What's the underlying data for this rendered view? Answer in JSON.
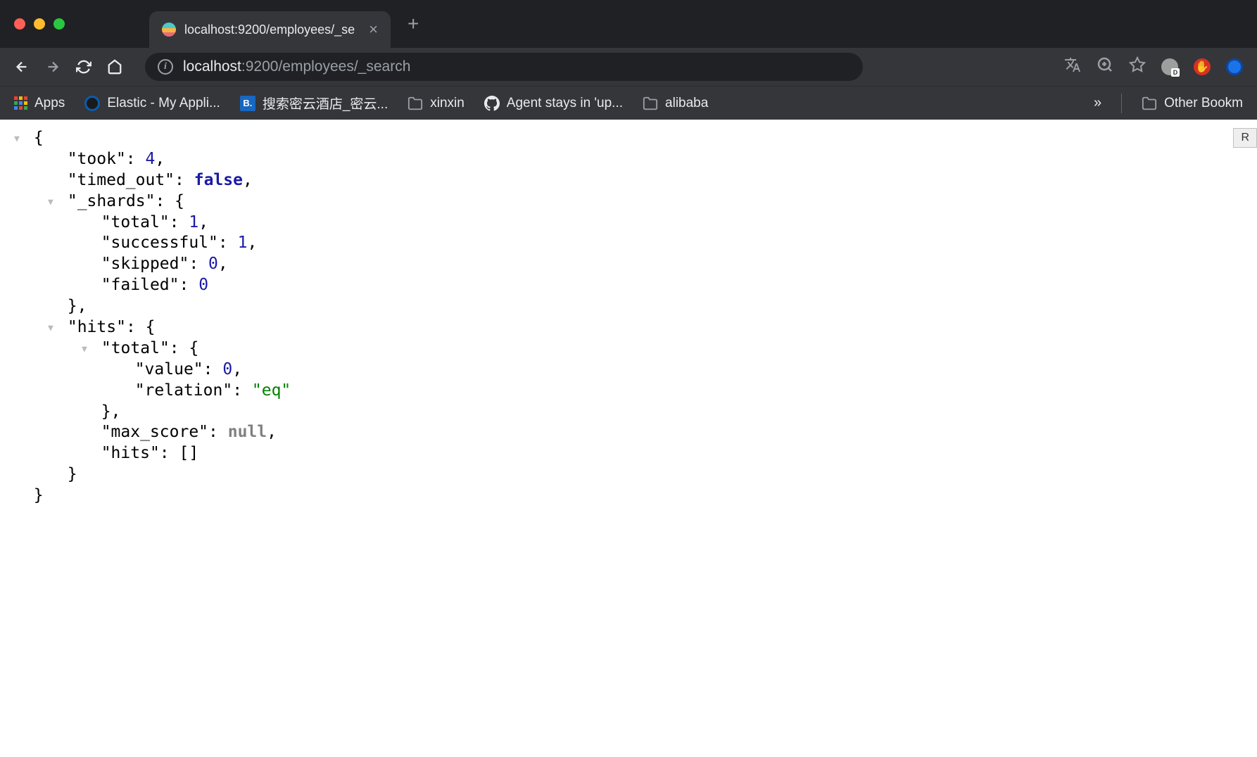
{
  "tab": {
    "title": "localhost:9200/employees/_se"
  },
  "url": {
    "host": "localhost",
    "rest": ":9200/employees/_search"
  },
  "bookmarks": {
    "apps": "Apps",
    "items": [
      {
        "label": "Elastic - My Appli...",
        "icon": "elastic"
      },
      {
        "label": "搜索密云酒店_密云...",
        "icon": "b"
      },
      {
        "label": "xinxin",
        "icon": "folder"
      },
      {
        "label": "Agent stays in 'up...",
        "icon": "github"
      },
      {
        "label": "alibaba",
        "icon": "folder"
      }
    ],
    "other": "Other Bookm"
  },
  "sidebutton": "R",
  "json": {
    "took": 4,
    "timed_out": false,
    "_shards": {
      "total": 1,
      "successful": 1,
      "skipped": 0,
      "failed": 0
    },
    "hits": {
      "total": {
        "value": 0,
        "relation": "eq"
      },
      "max_score": null,
      "hits": []
    }
  }
}
